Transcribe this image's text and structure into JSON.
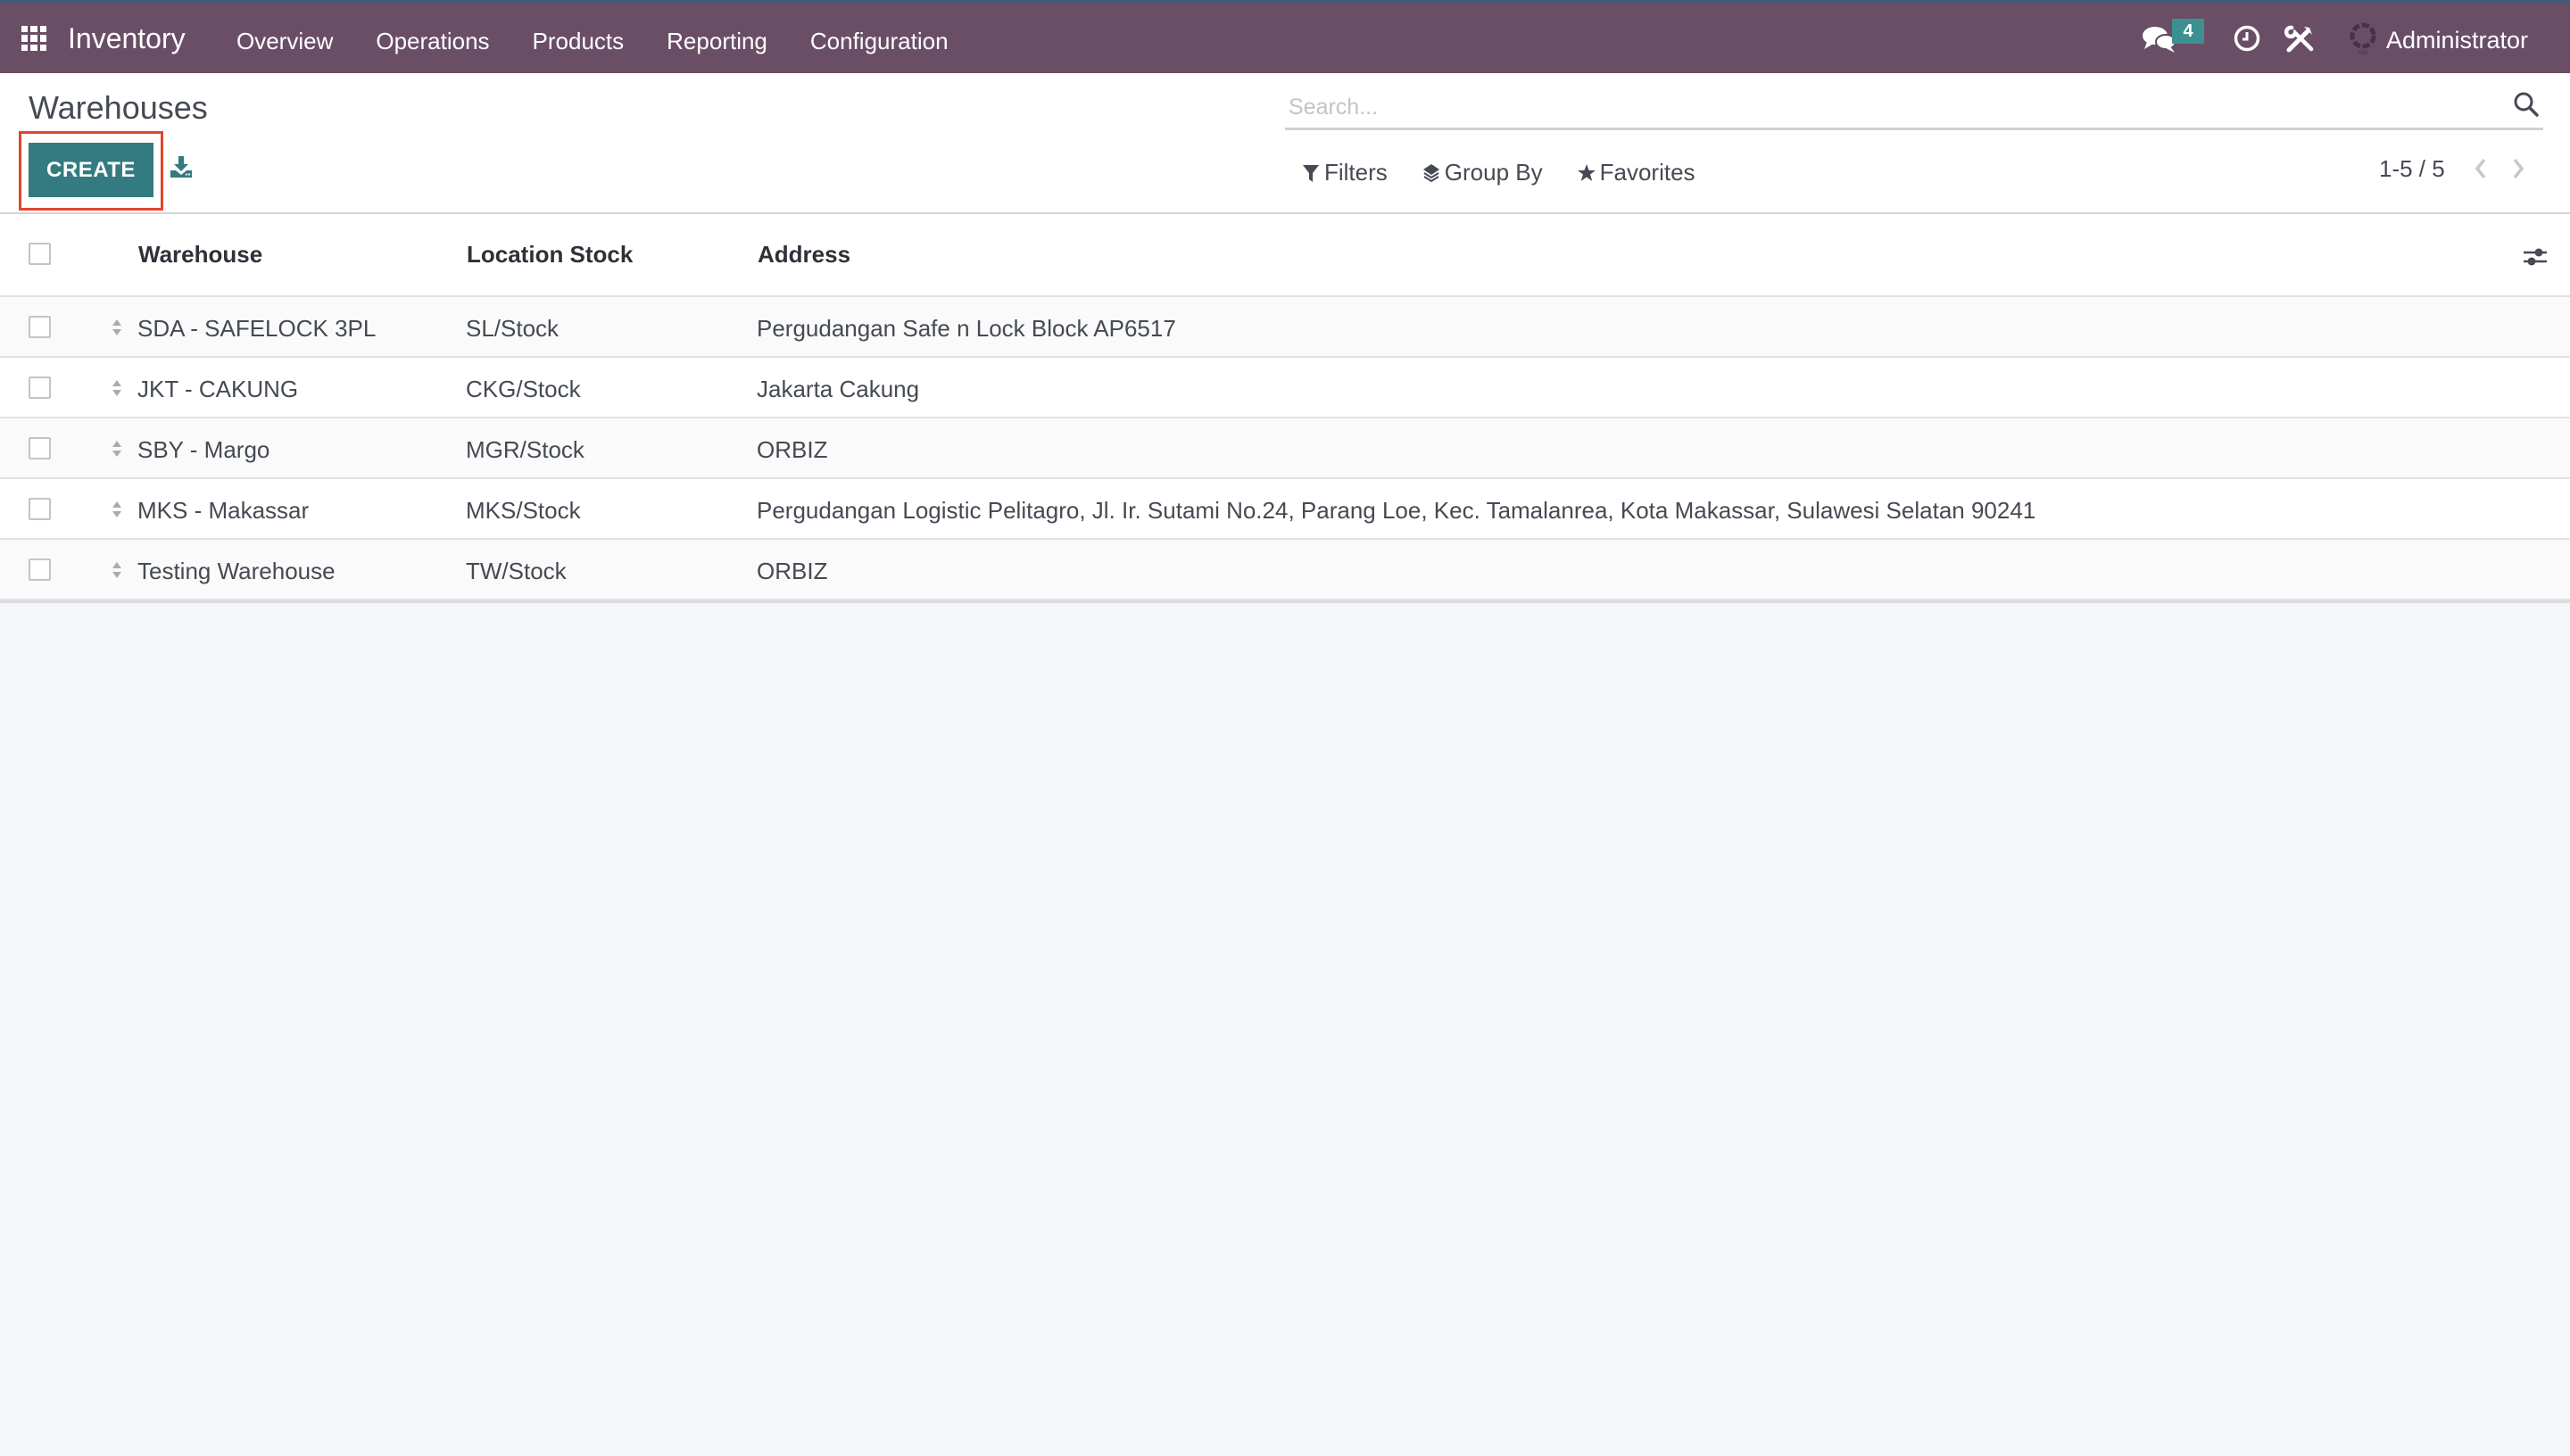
{
  "navbar": {
    "app_name": "Inventory",
    "menu": [
      "Overview",
      "Operations",
      "Products",
      "Reporting",
      "Configuration"
    ],
    "messages_badge": "4",
    "user_name": "Administrator",
    "colors": {
      "background": "#6a4e66",
      "badge": "#3d9090"
    }
  },
  "control_panel": {
    "title": "Warehouses",
    "create_label": "CREATE",
    "search_placeholder": "Search...",
    "search_value": "",
    "filters_label": "Filters",
    "group_by_label": "Group By",
    "favorites_label": "Favorites",
    "pager_value": "1-5 / 5",
    "colors": {
      "primary": "#337b80",
      "highlight": "#e0472f"
    }
  },
  "table": {
    "columns": [
      "Warehouse",
      "Location Stock",
      "Address"
    ],
    "rows": [
      {
        "warehouse": "SDA - SAFELOCK 3PL",
        "location": "SL/Stock",
        "address": "Pergudangan Safe n Lock Block AP6517"
      },
      {
        "warehouse": "JKT - CAKUNG",
        "location": "CKG/Stock",
        "address": "Jakarta Cakung"
      },
      {
        "warehouse": "SBY - Margo",
        "location": "MGR/Stock",
        "address": "ORBIZ"
      },
      {
        "warehouse": "MKS - Makassar",
        "location": "MKS/Stock",
        "address": "Pergudangan Logistic Pelitagro, Jl. Ir. Sutami No.24, Parang Loe, Kec. Tamalanrea, Kota Makassar, Sulawesi Selatan 90241"
      },
      {
        "warehouse": "Testing Warehouse",
        "location": "TW/Stock",
        "address": "ORBIZ"
      }
    ]
  }
}
